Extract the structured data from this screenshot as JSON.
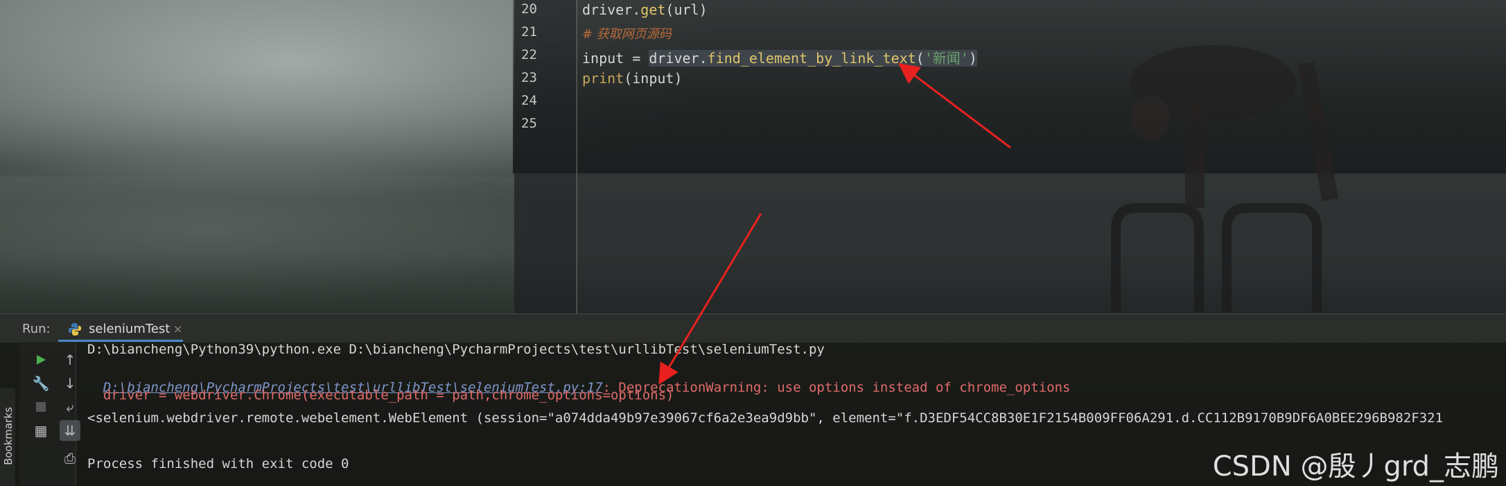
{
  "editor": {
    "lines": [
      {
        "num": "20",
        "tokens": [
          {
            "t": "driver.",
            "c": "tk-name"
          },
          {
            "t": "get",
            "c": "tk-call"
          },
          {
            "t": "(url)",
            "c": "tk-name"
          }
        ]
      },
      {
        "num": "21",
        "tokens": [
          {
            "t": "# 获取网页源码",
            "c": "tk-comment"
          }
        ]
      },
      {
        "num": "22",
        "tokens": [
          {
            "t": "input",
            "c": "tk-name"
          },
          {
            "t": " = ",
            "c": "tk-op"
          },
          {
            "t": "driver.",
            "c": "tk-name sel"
          },
          {
            "t": "find_element_by_link_text",
            "c": "tk-call sel"
          },
          {
            "t": "(",
            "c": "tk-name sel"
          },
          {
            "t": "'新闻'",
            "c": "tk-str sel"
          },
          {
            "t": ")",
            "c": "tk-name sel"
          }
        ]
      },
      {
        "num": "23",
        "tokens": [
          {
            "t": "print",
            "c": "tk-builtin"
          },
          {
            "t": "(input)",
            "c": "tk-name"
          }
        ]
      },
      {
        "num": "24",
        "tokens": []
      },
      {
        "num": "25",
        "tokens": []
      }
    ]
  },
  "run": {
    "label": "Run:",
    "tab_name": "seleniumTest",
    "tab_close": "×",
    "bookmarks_label": "Bookmarks",
    "output": {
      "line1": "D:\\biancheng\\Python39\\python.exe D:\\biancheng\\PycharmProjects\\test\\urllibTest\\seleniumTest.py",
      "line2_link": "D:\\biancheng\\PycharmProjects\\test\\urllibTest\\seleniumTest.py:17",
      "line2_rest": ": DeprecationWarning: use options instead of chrome_options",
      "line3": "  driver = webdriver.Chrome(executable_path = path,chrome_options=options)",
      "line4": "<selenium.webdriver.remote.webelement.WebElement (session=\"a074dda49b97e39067cf6a2e3ea9d9bb\", element=\"f.D3EDF54CC8B30E1F2154B009FF06A291.d.CC112B9170B9DF6A0BEE296B982F321",
      "line5": "",
      "line6": "Process finished with exit code 0"
    }
  },
  "watermark": "CSDN @殷丿grd_志鹏",
  "colors": {
    "accent_tab": "#4a88c7",
    "run_green": "#4caf50",
    "arrow_red": "#e8211f"
  }
}
